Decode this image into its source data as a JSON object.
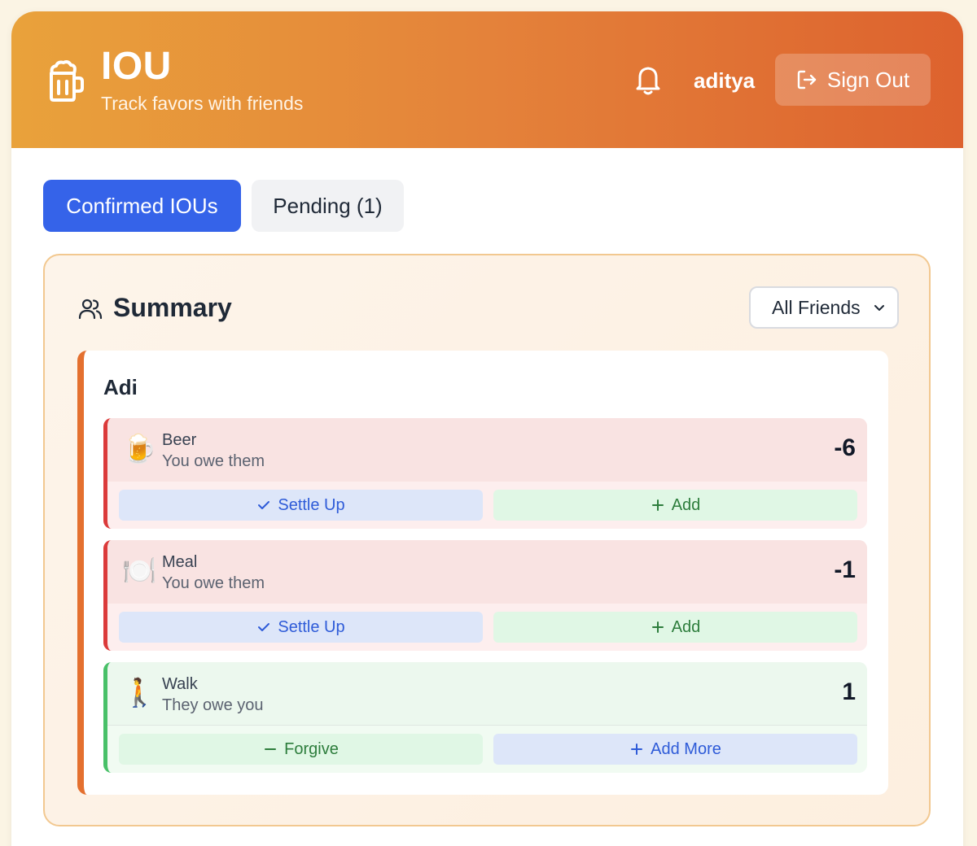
{
  "header": {
    "title": "IOU",
    "subtitle": "Track favors with friends",
    "username": "aditya",
    "sign_out_label": "Sign Out"
  },
  "tabs": [
    {
      "label": "Confirmed IOUs",
      "active": true
    },
    {
      "label": "Pending (1)",
      "active": false
    }
  ],
  "summary": {
    "title": "Summary",
    "filter_selected": "All Friends"
  },
  "friends": [
    {
      "name": "Adi",
      "ious": [
        {
          "emoji": "🍺",
          "name": "Beer",
          "description": "You owe them",
          "count": "-6",
          "primary_action": "Settle Up",
          "secondary_action": "Add"
        },
        {
          "emoji": "🍽️",
          "name": "Meal",
          "description": "You owe them",
          "count": "-1",
          "primary_action": "Settle Up",
          "secondary_action": "Add"
        },
        {
          "emoji": "🚶",
          "name": "Walk",
          "description": "They owe you",
          "count": "1",
          "primary_action": "Forgive",
          "secondary_action": "Add More"
        }
      ]
    }
  ],
  "colors": {
    "header_gradient_start": "#e9a23b",
    "header_gradient_end": "#dd622e",
    "primary_blue": "#3563e9",
    "owe_accent": "#db3a3a",
    "owed_accent": "#48c068"
  },
  "icons": {
    "logo": "beer-mug-icon",
    "bell": "bell-icon",
    "sign_out": "sign-out-icon",
    "summary": "users-icon",
    "select": "chevron-down-icon"
  }
}
